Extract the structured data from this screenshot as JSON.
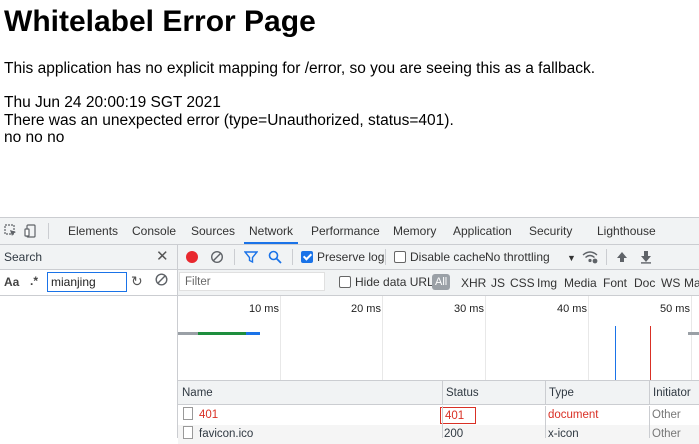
{
  "page": {
    "heading": "Whitelabel Error Page",
    "message": "This application has no explicit mapping for /error, so you are seeing this as a fallback.",
    "timestamp": "Thu Jun 24 20:00:19 SGT 2021",
    "error": "There was an unexpected error (type=Unauthorized, status=401).",
    "detail": "no no no"
  },
  "devtools": {
    "tabs": [
      "Elements",
      "Console",
      "Sources",
      "Network",
      "Performance",
      "Memory",
      "Application",
      "Security",
      "Lighthouse"
    ],
    "active_tab": "Network",
    "search": {
      "title": "Search",
      "case_label": "Aa",
      "regex_label": ".*",
      "query": "mianjing"
    },
    "toolbar": {
      "preserve_log": "Preserve log",
      "preserve_log_checked": true,
      "disable_cache": "Disable cache",
      "disable_cache_checked": false,
      "throttling": "No throttling"
    },
    "filter": {
      "placeholder": "Filter",
      "hide_data_urls": "Hide data URLs",
      "types": [
        "All",
        "XHR",
        "JS",
        "CSS",
        "Img",
        "Media",
        "Font",
        "Doc",
        "WS",
        "Ma"
      ]
    },
    "timeline": {
      "ticks": [
        "10 ms",
        "20 ms",
        "30 ms",
        "40 ms",
        "50 ms"
      ],
      "dom_content_color": "#1a73e8",
      "load_color": "#d93025"
    },
    "table": {
      "columns": [
        "Name",
        "Status",
        "Type",
        "Initiator"
      ],
      "rows": [
        {
          "name": "401",
          "status": "401",
          "type": "document",
          "initiator": "Other"
        },
        {
          "name": "favicon.ico",
          "status": "200",
          "type": "x-icon",
          "initiator": "Other"
        }
      ]
    }
  },
  "colors": {
    "accent": "#1a73e8",
    "error_red": "#d93025",
    "record_red": "#e8282e"
  }
}
